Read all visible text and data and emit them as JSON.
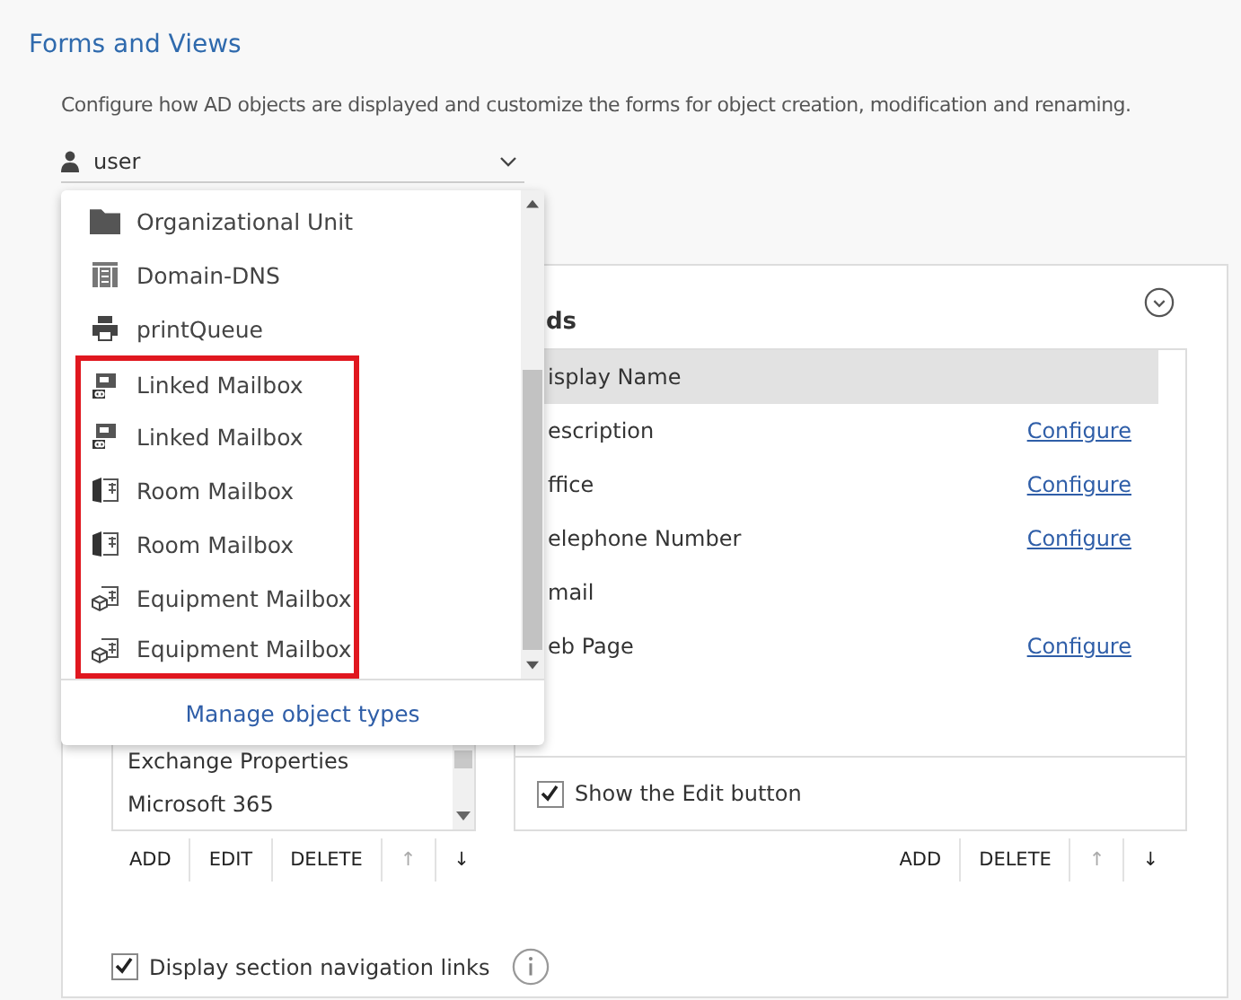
{
  "title": "Forms and Views",
  "description": "Configure how AD objects are displayed and customize the forms for object creation, modification and renaming.",
  "object_type": {
    "value": "user"
  },
  "dropdown": {
    "items": [
      {
        "label": "Organizational Unit",
        "kind": "folder",
        "highlighted": false
      },
      {
        "label": "Domain-DNS",
        "kind": "dns",
        "highlighted": false
      },
      {
        "label": "printQueue",
        "kind": "printer",
        "highlighted": false
      },
      {
        "label": "Linked Mailbox",
        "kind": "linked",
        "highlighted": true
      },
      {
        "label": "Linked Mailbox",
        "kind": "linked",
        "highlighted": true
      },
      {
        "label": "Room Mailbox",
        "kind": "room",
        "highlighted": true
      },
      {
        "label": "Room Mailbox",
        "kind": "room",
        "highlighted": true
      },
      {
        "label": "Equipment Mailbox",
        "kind": "equipment",
        "highlighted": true
      },
      {
        "label": "Equipment Mailbox",
        "kind": "equipment",
        "highlighted": true
      }
    ],
    "footer": "Manage object types"
  },
  "sections": [
    "Exchange Properties",
    "Microsoft 365"
  ],
  "fields": {
    "heading": "ds",
    "rows": [
      {
        "name": "isplay Name",
        "selected": true
      },
      {
        "name": "escription",
        "selected": false,
        "link": "Configure"
      },
      {
        "name": "ffice",
        "selected": false,
        "link": "Configure"
      },
      {
        "name": "elephone Number",
        "selected": false,
        "link": "Configure"
      },
      {
        "name": "mail",
        "selected": false
      },
      {
        "name": "eb Page",
        "selected": false,
        "link": "Configure"
      }
    ]
  },
  "show_edit_button": {
    "label": "Show the Edit button",
    "checked": true
  },
  "left_toolbar": [
    {
      "label": "ADD",
      "disabled": false
    },
    {
      "label": "EDIT",
      "disabled": false
    },
    {
      "label": "DELETE",
      "disabled": false
    },
    {
      "label": "↑",
      "disabled": true
    },
    {
      "label": "↓",
      "disabled": false
    }
  ],
  "right_toolbar": [
    {
      "label": "ADD",
      "disabled": false
    },
    {
      "label": "DELETE",
      "disabled": false
    },
    {
      "label": "↑",
      "disabled": true
    },
    {
      "label": "↓",
      "disabled": false
    }
  ],
  "nav_links": {
    "label": "Display section navigation links",
    "checked": true
  }
}
